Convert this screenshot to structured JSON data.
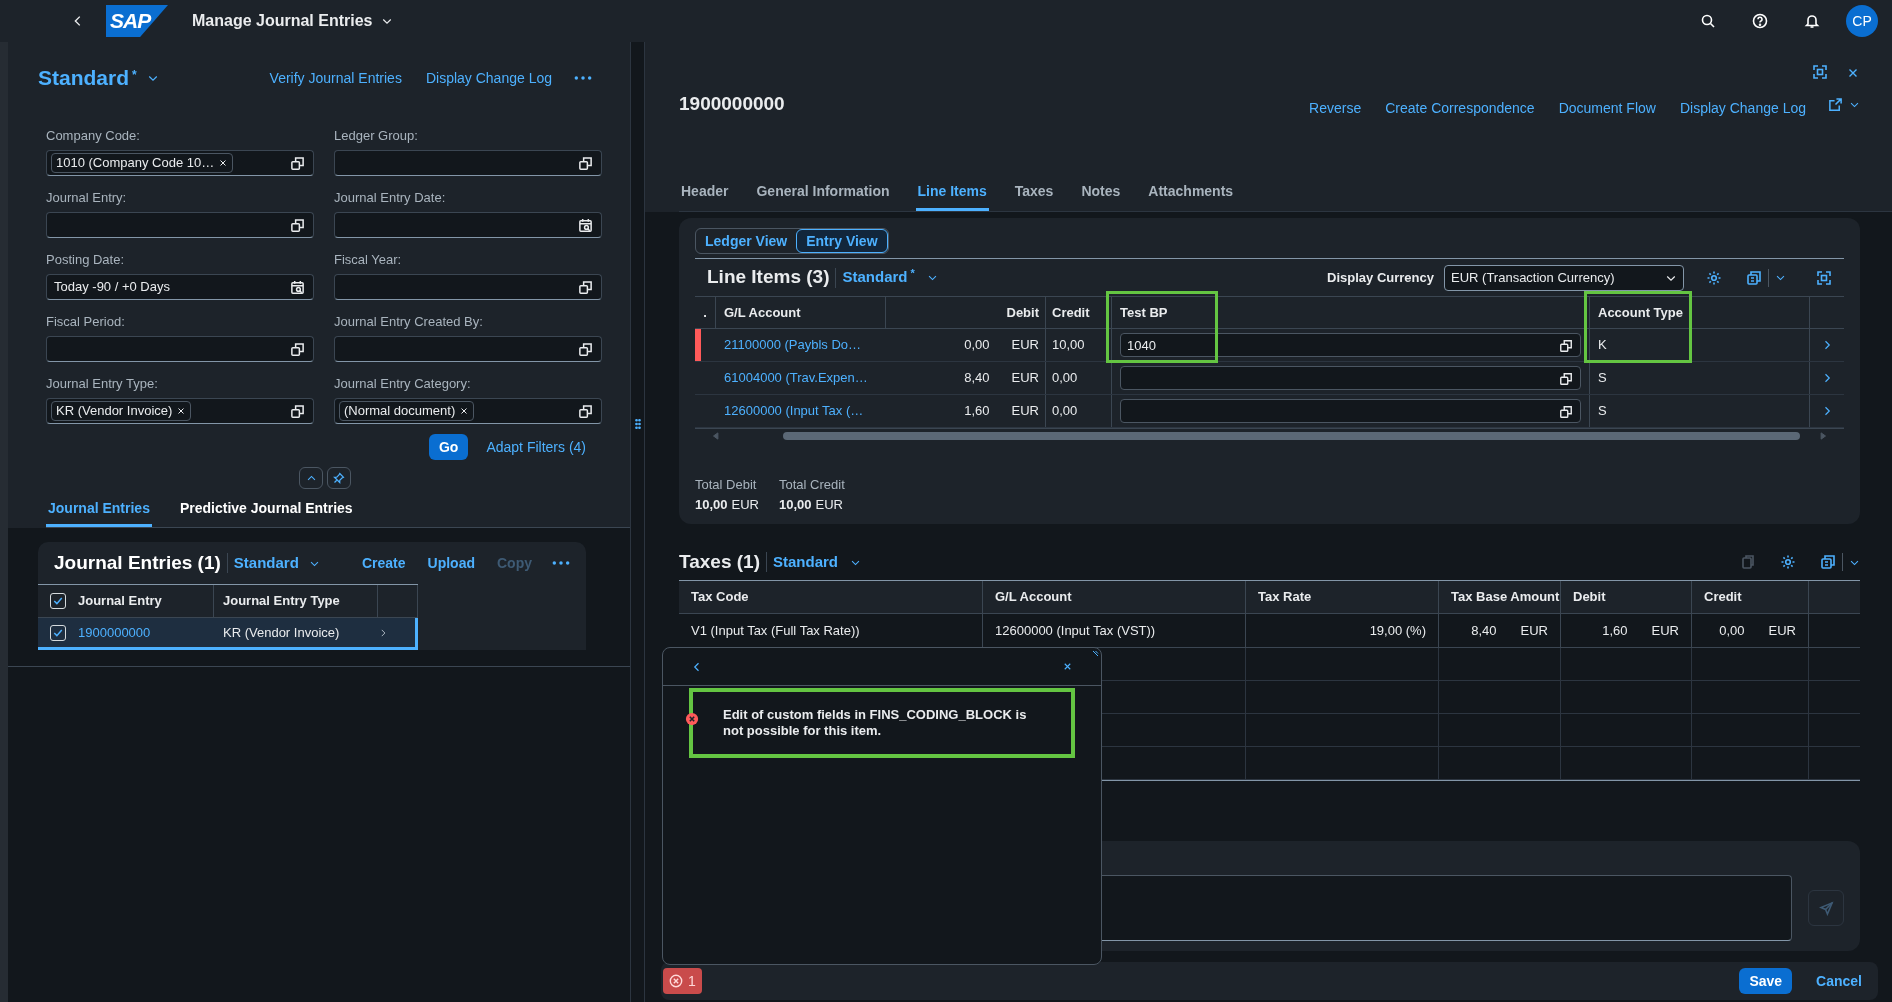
{
  "shell": {
    "logo": "SAP",
    "title": "Manage Journal Entries",
    "avatar": "CP"
  },
  "filter_bar": {
    "variant": "Standard",
    "variant_mark": "*",
    "actions": [
      "Verify Journal Entries",
      "Display Change Log"
    ],
    "fields": [
      {
        "label": "Company Code:",
        "token": "1010 (Company Code 10…",
        "kind": "lookup"
      },
      {
        "label": "Ledger Group:",
        "kind": "lookup"
      },
      {
        "label": "Journal Entry:",
        "kind": "lookup"
      },
      {
        "label": "Journal Entry Date:",
        "kind": "date"
      },
      {
        "label": "Posting Date:",
        "value": "Today -90 / +0 Days",
        "kind": "date"
      },
      {
        "label": "Fiscal Year:",
        "kind": "lookup"
      },
      {
        "label": "Fiscal Period:",
        "kind": "lookup"
      },
      {
        "label": "Journal Entry Created By:",
        "kind": "lookup"
      },
      {
        "label": "Journal Entry Type:",
        "token": "KR (Vendor Invoice)",
        "kind": "lookup"
      },
      {
        "label": "Journal Entry Category:",
        "token": "(Normal document)",
        "kind": "lookup"
      }
    ],
    "go": "Go",
    "adapt": "Adapt Filters (4)"
  },
  "left_tabs": [
    {
      "label": "Journal Entries",
      "selected": true
    },
    {
      "label": "Predictive Journal Entries",
      "selected": false
    }
  ],
  "entries_table": {
    "title": "Journal Entries (1)",
    "variant": "Standard",
    "actions": [
      {
        "label": "Create",
        "disabled": false
      },
      {
        "label": "Upload",
        "disabled": false
      },
      {
        "label": "Copy",
        "disabled": true
      }
    ],
    "header_checked": true,
    "columns": [
      "Journal Entry",
      "Journal Entry Type"
    ],
    "rows": [
      {
        "cells": [
          "1900000000",
          "KR (Vendor Invoice)"
        ],
        "checked": true,
        "selected": true
      }
    ]
  },
  "object": {
    "title": "1900000000",
    "actions": [
      "Reverse",
      "Create Correspondence",
      "Document Flow",
      "Display Change Log"
    ],
    "tabs": [
      {
        "label": "Header",
        "selected": false
      },
      {
        "label": "General Information",
        "selected": false
      },
      {
        "label": "Line Items",
        "selected": true
      },
      {
        "label": "Taxes",
        "selected": false
      },
      {
        "label": "Notes",
        "selected": false
      },
      {
        "label": "Attachments",
        "selected": false
      }
    ]
  },
  "line_items": {
    "views": [
      {
        "label": "Ledger View",
        "selected": false
      },
      {
        "label": "Entry View",
        "selected": true
      }
    ],
    "title": "Line Items (3)",
    "variant": "Standard",
    "variant_mark": "*",
    "currency_label": "Display Currency",
    "currency": "EUR (Transaction Currency)",
    "columns": [
      {
        "label": ".",
        "highlighted": false
      },
      {
        "label": "G/L Account",
        "highlighted": false
      },
      {
        "label": "Debit",
        "highlighted": false
      },
      {
        "label": "Credit",
        "highlighted": false
      },
      {
        "label": "Test BP",
        "highlighted": true
      },
      {
        "label": "Account Type",
        "highlighted": true
      }
    ],
    "rows": [
      {
        "account": "21100000 (Paybls Do…",
        "debit": "0,00",
        "debit_currency": "EUR",
        "credit": "10,00",
        "test_bp": "1040",
        "account_type": "K",
        "error": true
      },
      {
        "account": "61004000 (Trav.Expen…",
        "debit": "8,40",
        "debit_currency": "EUR",
        "credit": "0,00",
        "account_type": "S",
        "error": false
      },
      {
        "account": "12600000 (Input Tax (…",
        "debit": "1,60",
        "debit_currency": "EUR",
        "credit": "0,00",
        "account_type": "S",
        "error": false
      }
    ],
    "totals": [
      {
        "label": "Total Debit",
        "value": "10,00",
        "currency": "EUR"
      },
      {
        "label": "Total Credit",
        "value": "10,00",
        "currency": "EUR"
      }
    ]
  },
  "taxes": {
    "title": "Taxes (1)",
    "variant": "Standard",
    "columns": [
      "Tax Code",
      "G/L Account",
      "Tax Rate",
      "Tax Base Amount",
      "Debit",
      "Credit"
    ],
    "rows": [
      {
        "tax_code": "V1 (Input Tax (Full Tax Rate))",
        "account": "12600000 (Input Tax (VST))",
        "rate": "19,00 (%)",
        "base": "8,40",
        "base_currency": "EUR",
        "debit": "1,60",
        "debit_currency": "EUR",
        "credit": "0,00",
        "credit_currency": "EUR"
      }
    ]
  },
  "message_popover": {
    "messages": [
      {
        "kind": "error",
        "text": "Edit of custom fields in FINS_CODING_BLOCK is not possible for this item.",
        "highlighted": true
      }
    ]
  },
  "footer": {
    "error_count": "1",
    "buttons": [
      {
        "label": "Save",
        "kind": "primary"
      },
      {
        "label": "Cancel",
        "kind": "transparent"
      }
    ]
  }
}
